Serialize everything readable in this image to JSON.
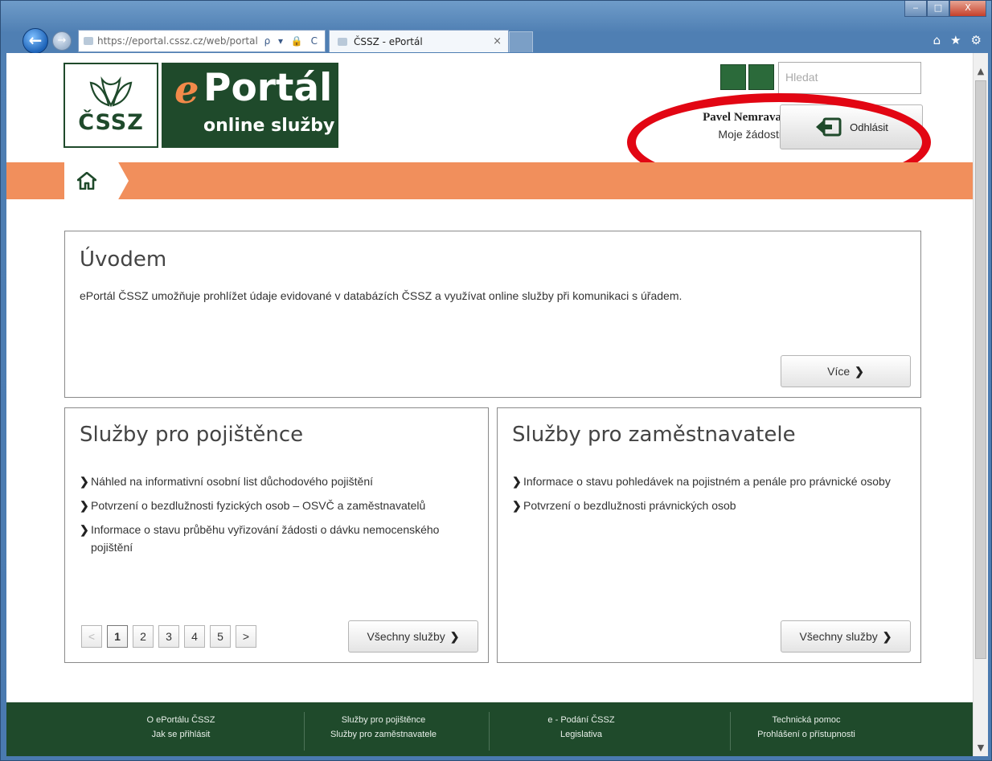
{
  "browser": {
    "url": "https://eportal.cssz.cz/web/portal",
    "tab_title": "ČSSZ - ePortál",
    "address_tools": "ρ ▾ 🔒 C",
    "tab_close": "×",
    "window_controls": {
      "minimize": "‒",
      "maximize": "□",
      "close": "X"
    },
    "toolbar_icons": [
      "home-icon",
      "star-icon",
      "gear-icon"
    ]
  },
  "header": {
    "logo": {
      "cssz": "ČSSZ",
      "e": "e",
      "portal": "Portál",
      "subtitle": "online služby"
    },
    "search_placeholder": "Hledat",
    "user_name": "Pavel Nemrava",
    "my_requests": "Moje žádosti",
    "logout_label": "Odhlásit"
  },
  "intro": {
    "title": "Úvodem",
    "text": "ePortál ČSSZ umožňuje prohlížet údaje evidované v databázích ČSSZ a využívat online služby při komunikaci s úřadem.",
    "more_label": "Více"
  },
  "insured": {
    "title": "Služby pro pojištěnce",
    "links": [
      "Náhled na informativní osobní list důchodového pojištění",
      "Potvrzení o bezdlužnosti fyzických osob – OSVČ a zaměstnavatelů",
      "Informace o stavu průběhu vyřizování žádosti o dávku nemocenského pojištění"
    ],
    "pager": {
      "prev": "<",
      "pages": [
        "1",
        "2",
        "3",
        "4",
        "5"
      ],
      "next": ">"
    },
    "all_label": "Všechny služby"
  },
  "employers": {
    "title": "Služby pro zaměstnavatele",
    "links": [
      "Informace o stavu pohledávek na pojistném a penále pro právnické osoby",
      "Potvrzení o bezdlužnosti právnických osob"
    ],
    "all_label": "Všechny služby"
  },
  "footer": {
    "columns": [
      [
        "O ePortálu ČSSZ",
        "Jak se přihlásit"
      ],
      [
        "Služby pro pojištěnce",
        "Služby pro zaměstnavatele"
      ],
      [
        "e - Podání ČSSZ",
        "Legislativa"
      ],
      [
        "Technická pomoc",
        "Prohlášení o přístupnosti"
      ]
    ]
  },
  "colors": {
    "brand_green": "#1f4a2b",
    "accent_orange": "#f18f5c",
    "highlight_red": "#e20613"
  }
}
